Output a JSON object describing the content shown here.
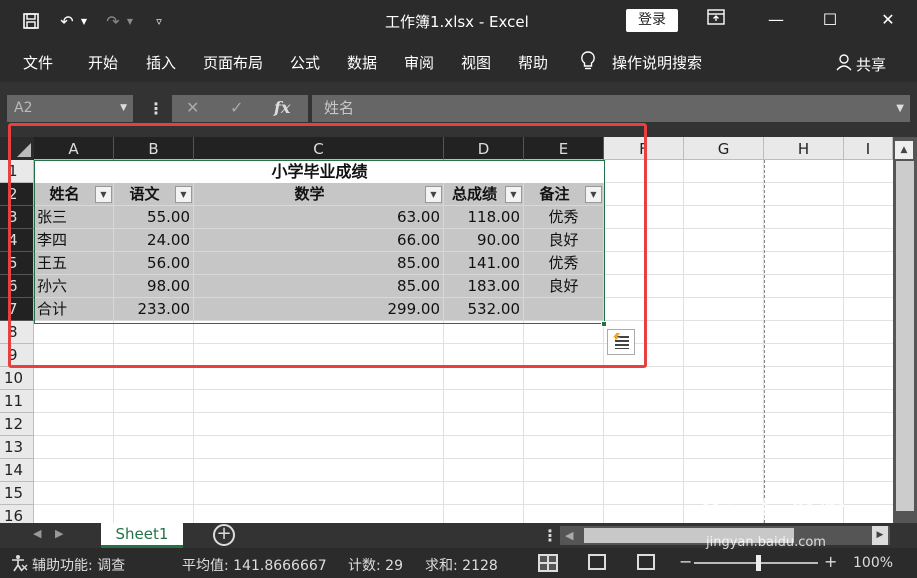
{
  "titlebar": {
    "title": "工作簿1.xlsx  -  Excel",
    "login": "登录"
  },
  "ribbon": {
    "tabs": [
      "文件",
      "开始",
      "插入",
      "页面布局",
      "公式",
      "数据",
      "审阅",
      "视图",
      "帮助"
    ],
    "tell_me": "操作说明搜索",
    "share": "共享"
  },
  "formula_bar": {
    "name_box": "A2",
    "fx_label": "fx",
    "value": "姓名"
  },
  "columns": [
    "A",
    "B",
    "C",
    "D",
    "E",
    "F",
    "G",
    "H",
    "I"
  ],
  "rows": [
    "1",
    "2",
    "3",
    "4",
    "5",
    "6",
    "7",
    "8",
    "9",
    "10",
    "11",
    "12",
    "13",
    "14",
    "15",
    "16"
  ],
  "table": {
    "title": "小学毕业成绩",
    "headers": [
      "姓名",
      "语文",
      "数学",
      "总成绩",
      "备注"
    ],
    "data": [
      [
        "张三",
        "55.00",
        "63.00",
        "118.00",
        "优秀"
      ],
      [
        "李四",
        "24.00",
        "66.00",
        "90.00",
        "良好"
      ],
      [
        "王五",
        "56.00",
        "85.00",
        "141.00",
        "优秀"
      ],
      [
        "孙六",
        "98.00",
        "85.00",
        "183.00",
        "良好"
      ],
      [
        "合计",
        "233.00",
        "299.00",
        "532.00",
        ""
      ]
    ]
  },
  "sheets": {
    "active": "Sheet1"
  },
  "status": {
    "accessibility": "辅助功能: 调查",
    "average": "平均值: 141.8666667",
    "count": "计数: 29",
    "sum": "求和: 2128",
    "zoom": "100%"
  },
  "watermark": {
    "brand": "Baidu经验",
    "url": "jingyan.baidu.com"
  }
}
